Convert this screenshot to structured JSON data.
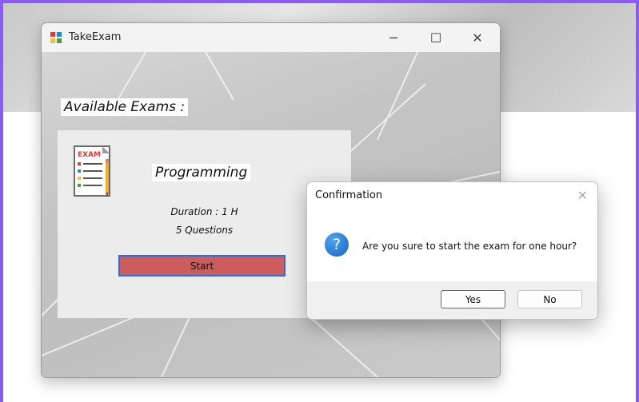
{
  "window": {
    "title": "TakeExam",
    "controls": {
      "minimize": "─",
      "maximize": "☐",
      "close": "✕"
    }
  },
  "main": {
    "heading": "Available Exams :",
    "exam": {
      "name": "Programming",
      "duration": "Duration : 1 H",
      "questions": "5 Questions",
      "start_label": "Start",
      "icon_text": "EXAM"
    }
  },
  "dialog": {
    "title": "Confirmation",
    "close": "✕",
    "question_mark": "?",
    "message": "Are you sure to start the exam for one hour?",
    "yes_label": "Yes",
    "no_label": "No"
  },
  "colors": {
    "accent_border": "#8a5cf5",
    "start_button": "#cd5c5c",
    "focus_blue": "#2a6fd6"
  }
}
